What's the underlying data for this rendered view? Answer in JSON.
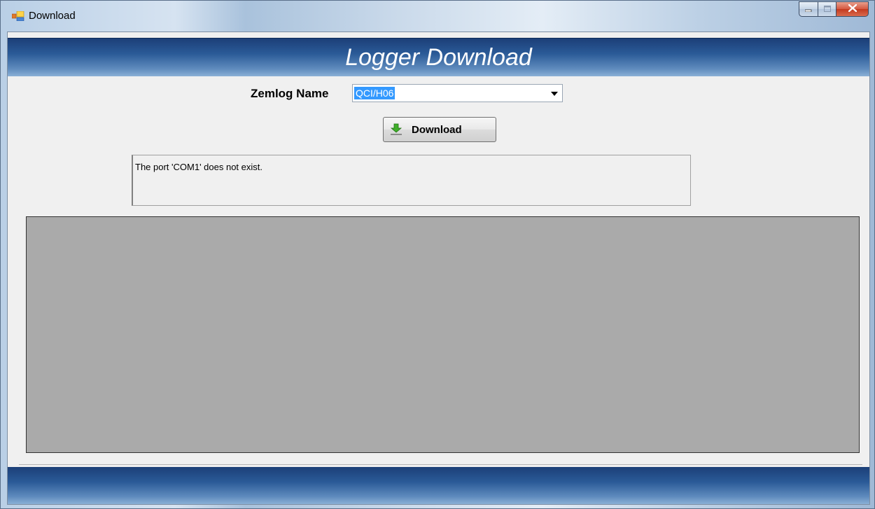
{
  "window": {
    "title": "Download",
    "icons": {
      "app": "app-window-icon",
      "minimize": "minimize-icon",
      "maximize": "maximize-icon",
      "close": "close-icon"
    }
  },
  "header": {
    "title": "Logger Download"
  },
  "form": {
    "zemlog_label": "Zemlog Name",
    "zemlog_value": "QCI/H06",
    "download_label": "Download",
    "download_icon": "download-arrow-icon"
  },
  "status": {
    "message": "The port 'COM1' does not exist."
  },
  "colors": {
    "header_band": "#2a5a97",
    "panel_gray": "#aaaaaa",
    "selection": "#3399ff"
  }
}
